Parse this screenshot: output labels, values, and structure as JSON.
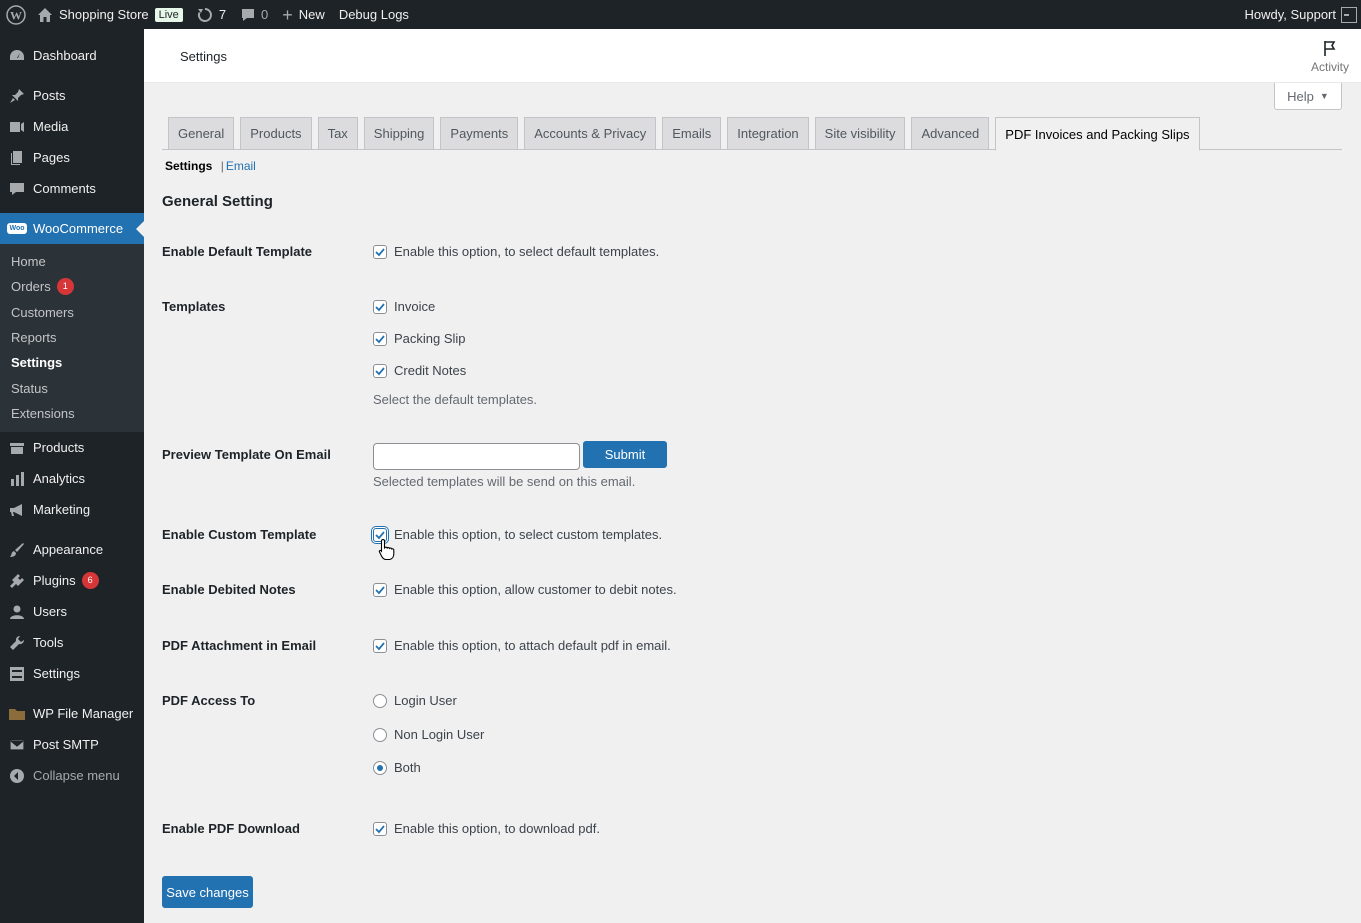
{
  "admin_bar": {
    "site_name": "Shopping Store",
    "live_badge": "Live",
    "updates_count": "7",
    "comments_count": "0",
    "new_label": "New",
    "debug_label": "Debug Logs",
    "greeting": "Howdy, Support"
  },
  "sidebar": {
    "dashboard": "Dashboard",
    "posts": "Posts",
    "media": "Media",
    "pages": "Pages",
    "comments": "Comments",
    "woocommerce": "WooCommerce",
    "woo_icon_text": "Woo",
    "sub": {
      "home": "Home",
      "orders": "Orders",
      "orders_badge": "1",
      "customers": "Customers",
      "reports": "Reports",
      "settings": "Settings",
      "status": "Status",
      "extensions": "Extensions"
    },
    "products": "Products",
    "analytics": "Analytics",
    "marketing": "Marketing",
    "appearance": "Appearance",
    "plugins": "Plugins",
    "plugins_badge": "6",
    "users": "Users",
    "tools": "Tools",
    "settings": "Settings",
    "wp_file_manager": "WP File Manager",
    "post_smtp": "Post SMTP",
    "collapse": "Collapse menu"
  },
  "header": {
    "title": "Settings",
    "activity": "Activity",
    "help": "Help"
  },
  "tabs": [
    "General",
    "Products",
    "Tax",
    "Shipping",
    "Payments",
    "Accounts & Privacy",
    "Emails",
    "Integration",
    "Site visibility",
    "Advanced",
    "PDF Invoices and Packing Slips"
  ],
  "active_tab": "PDF Invoices and Packing Slips",
  "subsub": {
    "settings": "Settings",
    "separator": "|",
    "email": "Email"
  },
  "section_title": "General Setting",
  "form": {
    "default_template": {
      "label": "Enable Default Template",
      "text": "Enable this option, to select default templates.",
      "checked": true
    },
    "templates": {
      "label": "Templates",
      "options": [
        {
          "text": "Invoice",
          "checked": true
        },
        {
          "text": "Packing Slip",
          "checked": true
        },
        {
          "text": "Credit Notes",
          "checked": true
        }
      ],
      "description": "Select the default templates."
    },
    "preview": {
      "label": "Preview Template On Email",
      "value": "",
      "button": "Submit",
      "description": "Selected templates will be send on this email."
    },
    "custom_template": {
      "label": "Enable Custom Template",
      "text": "Enable this option, to select custom templates.",
      "checked": true
    },
    "debited_notes": {
      "label": "Enable Debited Notes",
      "text": "Enable this option, allow customer to debit notes.",
      "checked": true
    },
    "pdf_attachment": {
      "label": "PDF Attachment in Email",
      "text": "Enable this option, to attach default pdf in email.",
      "checked": true
    },
    "pdf_access": {
      "label": "PDF Access To",
      "options": [
        "Login User",
        "Non Login User",
        "Both"
      ],
      "selected": "Both"
    },
    "pdf_download": {
      "label": "Enable PDF Download",
      "text": "Enable this option, to download pdf.",
      "checked": true
    }
  },
  "save_button": "Save changes",
  "colors": {
    "accent": "#2271b1",
    "admin_bg": "#1d2327",
    "submenu_bg": "#2c3338",
    "badge": "#d63638"
  }
}
